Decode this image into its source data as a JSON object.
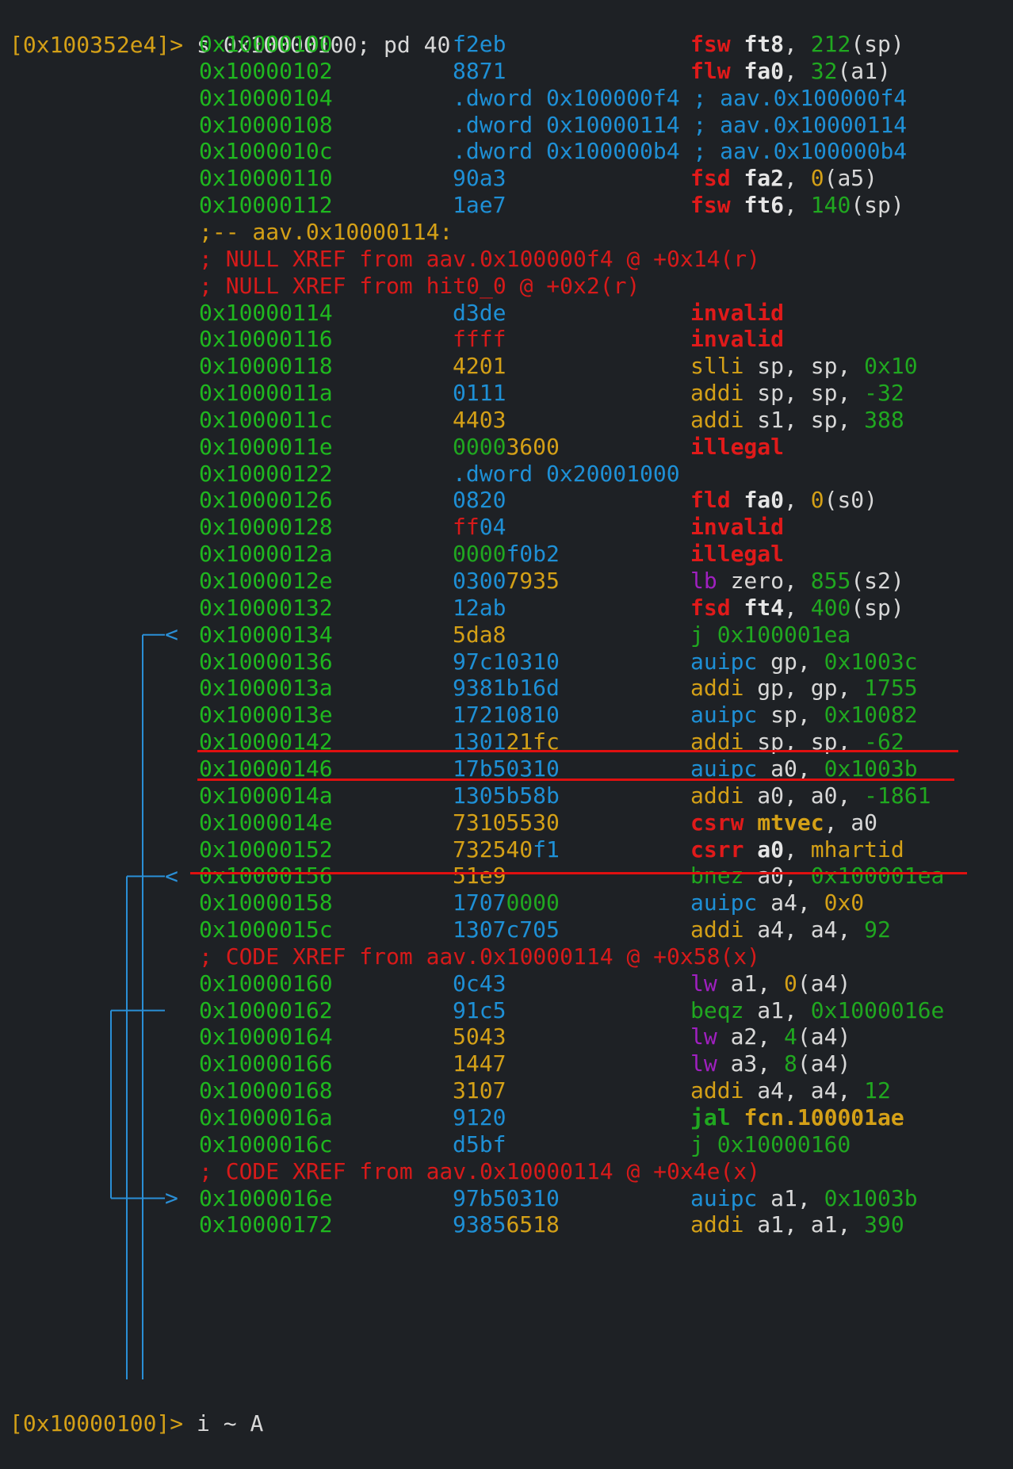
{
  "colors": {
    "background": "#1e2125",
    "address": "#1fb81f",
    "arrow": "#2a8fd6",
    "highlight_line": "#e01010"
  },
  "prompt": {
    "text": "[0x100352e4]> ",
    "command": "s 0x10000100; pd 40"
  },
  "footer_prompt": {
    "text": "[0x10000100]> ",
    "command": "i ~ A"
  },
  "rows": [
    {
      "kind": "ins",
      "addr": "0x10000100",
      "bytes": [
        [
          "f2eb",
          "blue"
        ]
      ],
      "instr": [
        [
          "fsw ",
          "boldred"
        ],
        [
          "ft8",
          "boldwhite"
        ],
        [
          ", ",
          "white"
        ],
        [
          "212",
          "green"
        ],
        [
          "(sp)",
          "white"
        ]
      ]
    },
    {
      "kind": "ins",
      "addr": "0x10000102",
      "bytes": [
        [
          "8871",
          "blue"
        ]
      ],
      "instr": [
        [
          "flw ",
          "boldred"
        ],
        [
          "fa0",
          "boldwhite"
        ],
        [
          ", ",
          "white"
        ],
        [
          "32",
          "green"
        ],
        [
          "(a1)",
          "white"
        ]
      ]
    },
    {
      "kind": "ins",
      "addr": "0x10000104",
      "bytes": [
        [
          ".dword 0x100000f4 ; aav.0x100000f4",
          "blue"
        ]
      ],
      "instr": []
    },
    {
      "kind": "ins",
      "addr": "0x10000108",
      "bytes": [
        [
          ".dword 0x10000114 ; aav.0x10000114",
          "blue"
        ]
      ],
      "instr": []
    },
    {
      "kind": "ins",
      "addr": "0x1000010c",
      "bytes": [
        [
          ".dword 0x100000b4 ; aav.0x100000b4",
          "blue"
        ]
      ],
      "instr": []
    },
    {
      "kind": "ins",
      "addr": "0x10000110",
      "bytes": [
        [
          "90a3",
          "blue"
        ]
      ],
      "instr": [
        [
          "fsd ",
          "boldred"
        ],
        [
          "fa2",
          "boldwhite"
        ],
        [
          ", ",
          "white"
        ],
        [
          "0",
          "yellow"
        ],
        [
          "(a5)",
          "white"
        ]
      ]
    },
    {
      "kind": "ins",
      "addr": "0x10000112",
      "bytes": [
        [
          "1ae7",
          "blue"
        ]
      ],
      "instr": [
        [
          "fsw ",
          "boldred"
        ],
        [
          "ft6",
          "boldwhite"
        ],
        [
          ", ",
          "white"
        ],
        [
          "140",
          "green"
        ],
        [
          "(sp)",
          "white"
        ]
      ]
    },
    {
      "kind": "flag",
      "text": ";-- aav.0x10000114:"
    },
    {
      "kind": "comment",
      "text": "; NULL XREF from aav.0x100000f4 @ +0x14(r)"
    },
    {
      "kind": "comment",
      "text": "; NULL XREF from hit0_0 @ +0x2(r)"
    },
    {
      "kind": "ins",
      "addr": "0x10000114",
      "bytes": [
        [
          "d3de",
          "blue"
        ]
      ],
      "instr": [
        [
          "invalid",
          "boldred"
        ]
      ]
    },
    {
      "kind": "ins",
      "addr": "0x10000116",
      "bytes": [
        [
          "ffff",
          "red"
        ]
      ],
      "instr": [
        [
          "invalid",
          "boldred"
        ]
      ]
    },
    {
      "kind": "ins",
      "addr": "0x10000118",
      "bytes": [
        [
          "4201",
          "yellow"
        ]
      ],
      "instr": [
        [
          "slli ",
          "yellow"
        ],
        [
          "sp, sp, ",
          "white"
        ],
        [
          "0x10",
          "green"
        ]
      ]
    },
    {
      "kind": "ins",
      "addr": "0x1000011a",
      "bytes": [
        [
          "0111",
          "blue"
        ]
      ],
      "instr": [
        [
          "addi ",
          "yellow"
        ],
        [
          "sp, sp, ",
          "white"
        ],
        [
          "-32",
          "green"
        ]
      ]
    },
    {
      "kind": "ins",
      "addr": "0x1000011c",
      "bytes": [
        [
          "4403",
          "yellow"
        ]
      ],
      "instr": [
        [
          "addi ",
          "yellow"
        ],
        [
          "s1, sp, ",
          "white"
        ],
        [
          "388",
          "green"
        ]
      ]
    },
    {
      "kind": "ins",
      "addr": "0x1000011e",
      "bytes": [
        [
          "0000",
          "green"
        ],
        [
          "3600",
          "yellow"
        ]
      ],
      "instr": [
        [
          "illegal",
          "boldred"
        ]
      ]
    },
    {
      "kind": "ins",
      "addr": "0x10000122",
      "bytes": [
        [
          ".dword 0x20001000",
          "blue"
        ]
      ],
      "instr": []
    },
    {
      "kind": "ins",
      "addr": "0x10000126",
      "bytes": [
        [
          "0820",
          "blue"
        ]
      ],
      "instr": [
        [
          "fld ",
          "boldred"
        ],
        [
          "fa0",
          "boldwhite"
        ],
        [
          ", ",
          "white"
        ],
        [
          "0",
          "yellow"
        ],
        [
          "(s0)",
          "white"
        ]
      ]
    },
    {
      "kind": "ins",
      "addr": "0x10000128",
      "bytes": [
        [
          "ff",
          "red"
        ],
        [
          "04",
          "blue"
        ]
      ],
      "instr": [
        [
          "invalid",
          "boldred"
        ]
      ]
    },
    {
      "kind": "ins",
      "addr": "0x1000012a",
      "bytes": [
        [
          "0000",
          "green"
        ],
        [
          "f0b2",
          "blue"
        ]
      ],
      "instr": [
        [
          "illegal",
          "boldred"
        ]
      ]
    },
    {
      "kind": "ins",
      "addr": "0x1000012e",
      "bytes": [
        [
          "0300",
          "blue"
        ],
        [
          "7935",
          "yellow"
        ]
      ],
      "instr": [
        [
          "lb ",
          "purple"
        ],
        [
          "zero, ",
          "white"
        ],
        [
          "855",
          "green"
        ],
        [
          "(s2)",
          "white"
        ]
      ]
    },
    {
      "kind": "ins",
      "addr": "0x10000132",
      "bytes": [
        [
          "12ab",
          "blue"
        ]
      ],
      "instr": [
        [
          "fsd ",
          "boldred"
        ],
        [
          "ft4",
          "boldwhite"
        ],
        [
          ", ",
          "white"
        ],
        [
          "400",
          "green"
        ],
        [
          "(sp)",
          "white"
        ]
      ]
    },
    {
      "kind": "ins",
      "addr": "0x10000134",
      "bytes": [
        [
          "5da8",
          "yellow"
        ]
      ],
      "instr": [
        [
          "j ",
          "green"
        ],
        [
          "0x100001ea",
          "green"
        ]
      ]
    },
    {
      "kind": "ins",
      "addr": "0x10000136",
      "bytes": [
        [
          "97c10310",
          "blue"
        ]
      ],
      "instr": [
        [
          "auipc ",
          "blue"
        ],
        [
          "gp, ",
          "white"
        ],
        [
          "0x1003c",
          "green"
        ]
      ]
    },
    {
      "kind": "ins",
      "addr": "0x1000013a",
      "bytes": [
        [
          "9381b16d",
          "blue"
        ]
      ],
      "instr": [
        [
          "addi ",
          "yellow"
        ],
        [
          "gp, gp, ",
          "white"
        ],
        [
          "1755",
          "green"
        ]
      ]
    },
    {
      "kind": "ins",
      "addr": "0x1000013e",
      "bytes": [
        [
          "1721",
          "blue"
        ],
        [
          "0810",
          "blue"
        ]
      ],
      "instr": [
        [
          "auipc ",
          "blue"
        ],
        [
          "sp, ",
          "white"
        ],
        [
          "0x10082",
          "green"
        ]
      ]
    },
    {
      "kind": "ins",
      "addr": "0x10000142",
      "bytes": [
        [
          "1301",
          "blue"
        ],
        [
          "21fc",
          "yellow"
        ]
      ],
      "instr": [
        [
          "addi ",
          "yellow"
        ],
        [
          "sp, sp, ",
          "white"
        ],
        [
          "-62",
          "green"
        ]
      ]
    },
    {
      "kind": "ins",
      "addr": "0x10000146",
      "bytes": [
        [
          "17b50310",
          "blue"
        ]
      ],
      "instr": [
        [
          "auipc ",
          "blue"
        ],
        [
          "a0, ",
          "white"
        ],
        [
          "0x1003b",
          "green"
        ]
      ]
    },
    {
      "kind": "ins",
      "addr": "0x1000014a",
      "bytes": [
        [
          "1305b58b",
          "blue"
        ]
      ],
      "instr": [
        [
          "addi ",
          "yellow"
        ],
        [
          "a0, a0, ",
          "white"
        ],
        [
          "-1861",
          "green"
        ]
      ]
    },
    {
      "kind": "ins",
      "addr": "0x1000014e",
      "bytes": [
        [
          "73105530",
          "yellow"
        ]
      ],
      "instr": [
        [
          "csrw ",
          "boldred"
        ],
        [
          "mtvec",
          "boldyellow"
        ],
        [
          ", a0",
          "white"
        ]
      ]
    },
    {
      "kind": "ins",
      "addr": "0x10000152",
      "bytes": [
        [
          "732540",
          "yellow"
        ],
        [
          "f1",
          "blue"
        ]
      ],
      "instr": [
        [
          "csrr ",
          "boldred"
        ],
        [
          "a0",
          "boldwhite"
        ],
        [
          ", ",
          "white"
        ],
        [
          "mhartid",
          "yellow"
        ]
      ]
    },
    {
      "kind": "ins",
      "addr": "0x10000156",
      "bytes": [
        [
          "51e9",
          "yellow"
        ]
      ],
      "instr": [
        [
          "bnez ",
          "green"
        ],
        [
          "a0, ",
          "white"
        ],
        [
          "0x100001ea",
          "green"
        ]
      ]
    },
    {
      "kind": "ins",
      "addr": "0x10000158",
      "bytes": [
        [
          "1707",
          "blue"
        ],
        [
          "0000",
          "green"
        ]
      ],
      "instr": [
        [
          "auipc ",
          "blue"
        ],
        [
          "a4, ",
          "white"
        ],
        [
          "0x0",
          "yellow"
        ]
      ]
    },
    {
      "kind": "ins",
      "addr": "0x1000015c",
      "bytes": [
        [
          "1307c705",
          "blue"
        ]
      ],
      "instr": [
        [
          "addi ",
          "yellow"
        ],
        [
          "a4, a4, ",
          "white"
        ],
        [
          "92",
          "green"
        ]
      ]
    },
    {
      "kind": "comment",
      "text": "; CODE XREF from aav.0x10000114 @ +0x58(x)"
    },
    {
      "kind": "ins",
      "addr": "0x10000160",
      "bytes": [
        [
          "0c43",
          "blue"
        ]
      ],
      "instr": [
        [
          "lw ",
          "purple"
        ],
        [
          "a1, ",
          "white"
        ],
        [
          "0",
          "yellow"
        ],
        [
          "(a4)",
          "white"
        ]
      ]
    },
    {
      "kind": "ins",
      "addr": "0x10000162",
      "bytes": [
        [
          "91c5",
          "blue"
        ]
      ],
      "instr": [
        [
          "beqz ",
          "green"
        ],
        [
          "a1, ",
          "white"
        ],
        [
          "0x1000016e",
          "green"
        ]
      ]
    },
    {
      "kind": "ins",
      "addr": "0x10000164",
      "bytes": [
        [
          "5043",
          "yellow"
        ]
      ],
      "instr": [
        [
          "lw ",
          "purple"
        ],
        [
          "a2, ",
          "white"
        ],
        [
          "4",
          "green"
        ],
        [
          "(a4)",
          "white"
        ]
      ]
    },
    {
      "kind": "ins",
      "addr": "0x10000166",
      "bytes": [
        [
          "1447",
          "yellow"
        ]
      ],
      "instr": [
        [
          "lw ",
          "purple"
        ],
        [
          "a3, ",
          "white"
        ],
        [
          "8",
          "green"
        ],
        [
          "(a4)",
          "white"
        ]
      ]
    },
    {
      "kind": "ins",
      "addr": "0x10000168",
      "bytes": [
        [
          "3107",
          "yellow"
        ]
      ],
      "instr": [
        [
          "addi ",
          "yellow"
        ],
        [
          "a4, a4, ",
          "white"
        ],
        [
          "12",
          "green"
        ]
      ]
    },
    {
      "kind": "ins",
      "addr": "0x1000016a",
      "bytes": [
        [
          "9120",
          "blue"
        ]
      ],
      "instr": [
        [
          "jal ",
          "boldgreen"
        ],
        [
          "fcn.100001ae",
          "boldyellow"
        ]
      ]
    },
    {
      "kind": "ins",
      "addr": "0x1000016c",
      "bytes": [
        [
          "d5bf",
          "blue"
        ]
      ],
      "instr": [
        [
          "j ",
          "green"
        ],
        [
          "0x10000160",
          "green"
        ]
      ]
    },
    {
      "kind": "comment",
      "text": "; CODE XREF from aav.0x10000114 @ +0x4e(x)"
    },
    {
      "kind": "ins",
      "addr": "0x1000016e",
      "bytes": [
        [
          "97b50310",
          "blue"
        ]
      ],
      "instr": [
        [
          "auipc ",
          "blue"
        ],
        [
          "a1, ",
          "white"
        ],
        [
          "0x1003b",
          "green"
        ]
      ]
    },
    {
      "kind": "ins",
      "addr": "0x10000172",
      "bytes": [
        [
          "9385",
          "blue"
        ],
        [
          "6518",
          "yellow"
        ]
      ],
      "instr": [
        [
          "addi ",
          "yellow"
        ],
        [
          "a1, a1, ",
          "white"
        ],
        [
          "390",
          "green"
        ]
      ]
    }
  ]
}
